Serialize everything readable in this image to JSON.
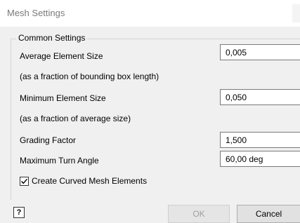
{
  "window": {
    "title": "Mesh Settings"
  },
  "group": {
    "legend": "Common Settings"
  },
  "fields": {
    "average_element_size": {
      "label": "Average Element Size",
      "hint": "(as a fraction of bounding box length)",
      "value": "0,005"
    },
    "minimum_element_size": {
      "label": "Minimum Element Size",
      "hint": "(as a fraction of average size)",
      "value": "0,050"
    },
    "grading_factor": {
      "label": "Grading Factor",
      "value": "1,500"
    },
    "maximum_turn_angle": {
      "label": "Maximum Turn Angle",
      "value": "60,00 deg"
    }
  },
  "checkbox": {
    "label": "Create Curved Mesh Elements",
    "checked": true
  },
  "buttons": {
    "help_label": "?",
    "ok_label": "OK",
    "ok_enabled": false,
    "cancel_label": "Cancel"
  },
  "icons": {
    "help": "question-mark-icon",
    "check": "checkmark-icon"
  },
  "colors": {
    "title_text": "#7a7a7a",
    "disabled_text": "#a0a0a0",
    "dialog_bg": "#f0f0f0"
  }
}
